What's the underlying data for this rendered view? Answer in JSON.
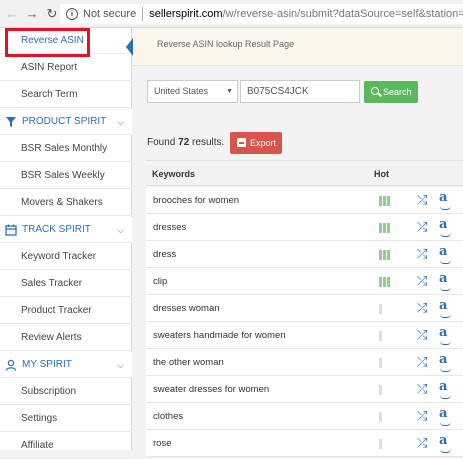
{
  "browser": {
    "security": "Not secure",
    "url_host": "sellerspirit.com",
    "url_path": "/w/reverse-asin/submit?dataSource=self&station=COM"
  },
  "sidebar": {
    "items": [
      {
        "label": "Reverse ASIN"
      },
      {
        "label": "ASIN Report"
      },
      {
        "label": "Search Term"
      }
    ],
    "sections": [
      {
        "label": "PRODUCT SPIRIT",
        "items": [
          "BSR Sales Monthly",
          "BSR Sales Weekly",
          "Movers & Shakers"
        ]
      },
      {
        "label": "TRACK SPIRIT",
        "items": [
          "Keyword Tracker",
          "Sales Tracker",
          "Product Tracker",
          "Review Alerts"
        ]
      },
      {
        "label": "MY SPIRIT",
        "items": [
          "Subscription",
          "Settings",
          "Affiliate"
        ]
      }
    ]
  },
  "banner": {
    "title": "Reverse ASIN lookup Result Page"
  },
  "search": {
    "country": "United States",
    "asin_value": "B075CS4JCK",
    "button": "Search"
  },
  "results": {
    "found_prefix": "Found",
    "count": "72",
    "found_suffix": "results.",
    "export": "Export"
  },
  "table": {
    "col_keywords": "Keywords",
    "col_hot": "Hot",
    "rows": [
      {
        "keyword": "brooches for women",
        "hot": 3
      },
      {
        "keyword": "dresses",
        "hot": 3
      },
      {
        "keyword": "dress",
        "hot": 3
      },
      {
        "keyword": "clip",
        "hot": 3
      },
      {
        "keyword": "dresses woman",
        "hot": 0
      },
      {
        "keyword": "sweaters handmade for women",
        "hot": 0
      },
      {
        "keyword": "the other woman",
        "hot": 0
      },
      {
        "keyword": "sweater dresses for women",
        "hot": 0
      },
      {
        "keyword": "clothes",
        "hot": 0
      },
      {
        "keyword": "rose",
        "hot": 0
      }
    ]
  },
  "colors": {
    "accent": "#2d6fb7",
    "search_button": "#5cb85c",
    "export_button": "#d9534f",
    "hot_on": "#8fd08f",
    "highlight_box": "#e0141e"
  }
}
